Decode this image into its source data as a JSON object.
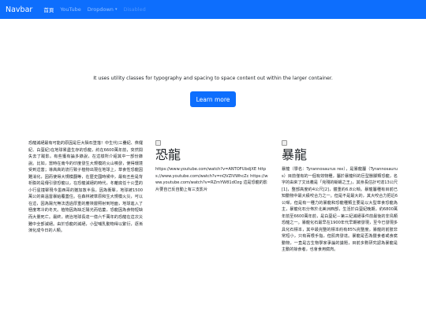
{
  "navbar": {
    "brand": "Navbar",
    "items": [
      {
        "label": "首頁",
        "state": "active"
      },
      {
        "label": "YouTube",
        "state": "normal"
      },
      {
        "label": "Dropdown",
        "state": "normal",
        "caret": "▾"
      },
      {
        "label": "Disabled",
        "state": "disabled"
      }
    ]
  },
  "hero": {
    "text": "It uses utility classes for typography and spacing to space content out within the larger container.",
    "button_label": "Learn more"
  },
  "column1": {
    "text": "恐龍滅絕最有可能的原因是巨大隕石墜落！中生代(三疊紀、侏儸紀、白堊紀)在地球累盡生存的恐龍，約在6600萬年前，突然間失去了蹤影。有些獲有論多錄說，在這樣所介紹其中一部份錄說。比如，當時在南今的印度發生大規模的火山噴發，使得環境受到這害；導高高的流行致子植物出現在地球上，草食性恐龍因難消化，因而使得大規模翻等，在歷史國時候中，最有丕些是背析膨的是傳引發恐龍以，在恐龍滅絕的時代，冬離底任十公里的小行星撞擊現今墨西哥的猶加敦半島，因為衝擊，地球被1500萬公的高溫雷暴給覆蓋住。在森林被草原和生大規模火災，可以在這，因為陽光無法透過厚重的塵埃層照射到地面，地球進入了極度寒冷的冬天。植物因為缺乏陽光而枯萎，恐龍因為食物短缺而大量死亡。最終，統治地球長達一億六千萬年的恐龍在這次災難中全部滅絕。由於恐龍的滅絕，小型哺乳動物得以繁衍，逐漸演化成今日的人類。"
  },
  "card2": {
    "title": "恐龍",
    "body": "https://www.youtube.com/watch?v=ANTOFUbdjXE https://www.youtube.com/watch?v=nQVZIVWhcZc https://www.youtube.com/watch?v=RZmYW81dOzg 這是恐龍的影片要自己反自動上有三支影片"
  },
  "card3": {
    "title": "暴龍",
    "body": "暴龍（學名：Tyrannosaurus rex），是暴龍屬（Tyrannosaurus）目前僅有的一個有效物種，屬於暴龍科的巨型獸腳類恐龍，名字的由來了文出義是「兇殘的蜥蜴之王」，其身長估計可達13公尺[1]，整部高度約4公尺[2]，體重約6.8公噸。暴龍屬種有目前已知動物中最大級咬合力之一。但是不是最大的，其大咬合力把近6公噸，但是有一種力的暴龍和恐龍種類主要是以大型草食恐龍為主，暴龍化石分佈於北美洲西部，生活於白堊紀晚期，約6800萬年前至6600萬年前，是白堊紀－第三紀滅絕事件前最後的非鳥類恐龍之一。暴龍化石最早在1900年代早期被發現，至今已發現多具化石標本，其中最完整的標本約有85%完整度。暴龍的前肢非常短小，只有兩根手指，但肌肉發達。暴龍是否為獵食者或食腐動物，一直是古生物學家爭論的議題，目前多數研究認為暴龍是主動的掠食者，也會食用腐肉。"
  }
}
